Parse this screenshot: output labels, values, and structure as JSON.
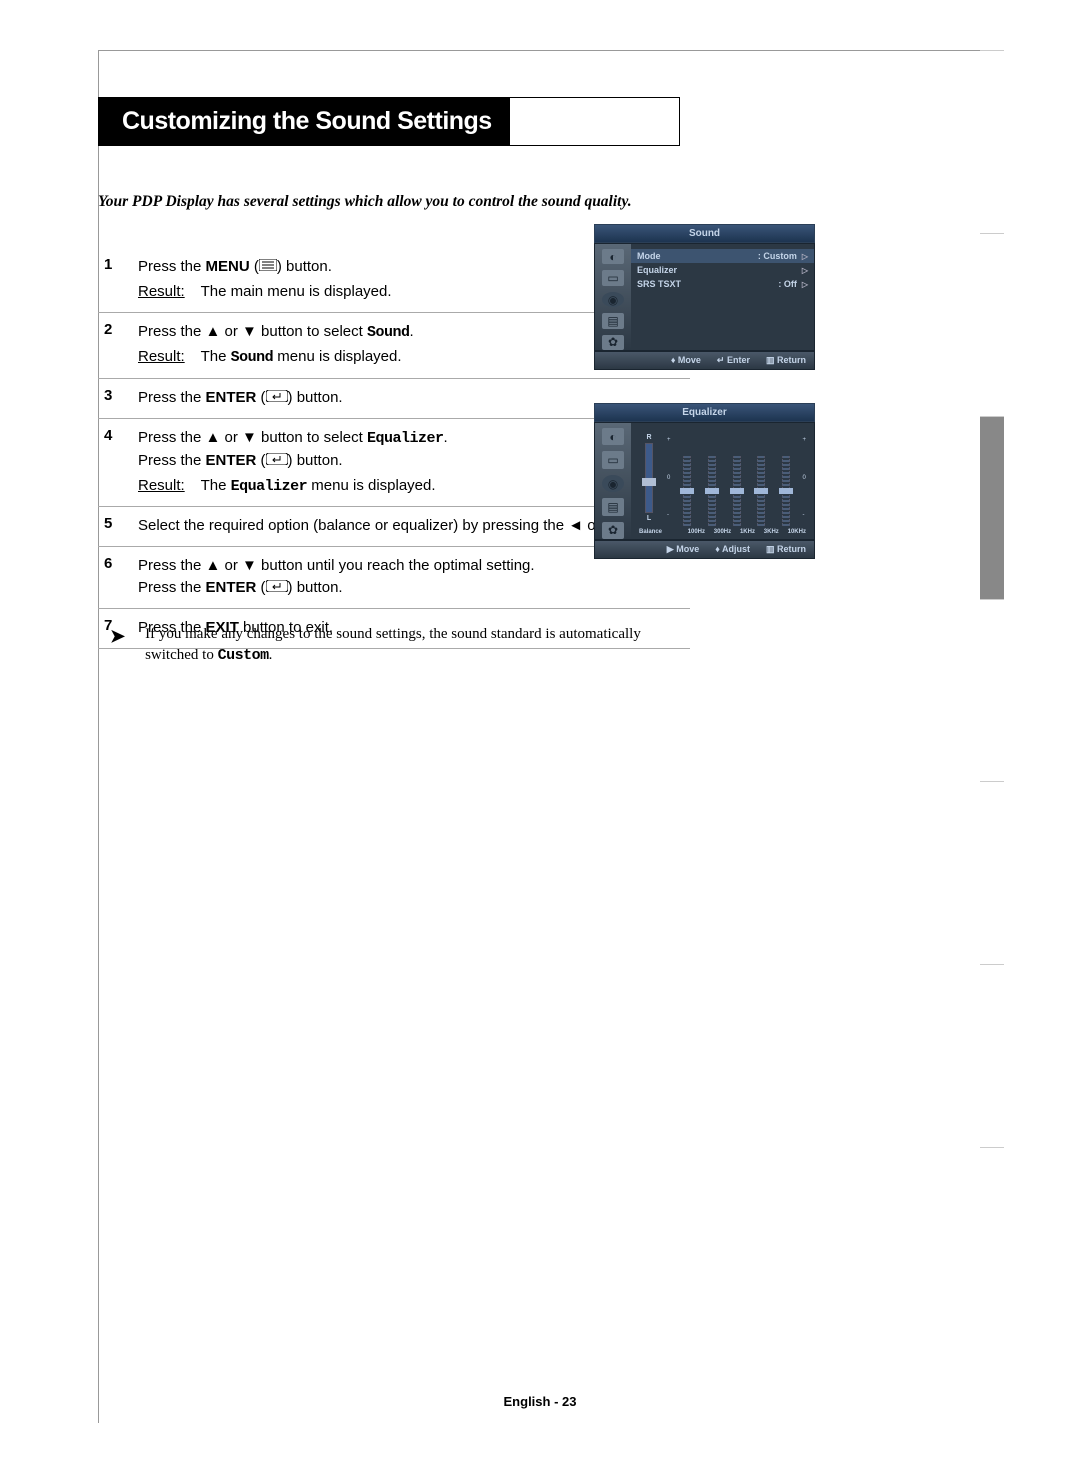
{
  "title": "Customizing the Sound Settings",
  "intro": "Your PDP Display has several settings which allow you to control the sound quality.",
  "steps": {
    "s1": {
      "num": "1",
      "a": "Press the ",
      "b": "MENU",
      "c": " (",
      "d": ") button.",
      "result_label": "Result:",
      "result": "The main menu is displayed."
    },
    "s2": {
      "num": "2",
      "a": "Press the ▲ or ▼ button to select ",
      "b": "Sound",
      "c": ".",
      "result_label": "Result:",
      "result_a": "The ",
      "result_b": "Sound",
      "result_c": " menu is displayed."
    },
    "s3": {
      "num": "3",
      "a": "Press the ",
      "b": "ENTER",
      "c": " (",
      "d": ") button."
    },
    "s4": {
      "num": "4",
      "a": "Press the ▲ or ▼ button to select ",
      "b": "Equalizer",
      "c": ".",
      "l2a": "Press the ",
      "l2b": "ENTER",
      "l2c": " (",
      "l2d": ") button.",
      "result_label": "Result:",
      "result_a": "The ",
      "result_b": "Equalizer",
      "result_c": " menu is displayed."
    },
    "s5": {
      "num": "5",
      "a": "Select the required option (balance or equalizer) by pressing the ◄ or ► button."
    },
    "s6": {
      "num": "6",
      "a": "Press the ▲ or ▼ button until you reach the optimal setting.",
      "l2a": "Press the ",
      "l2b": "ENTER",
      "l2c": " (",
      "l2d": ") button."
    },
    "s7": {
      "num": "7",
      "a": "Press the ",
      "b": "EXIT",
      "c": " button to exit."
    }
  },
  "note": {
    "a": "If you make any changes to the sound settings, the sound standard is automatically switched to ",
    "b": "Custom",
    "c": "."
  },
  "osd1": {
    "title": "Sound",
    "rows": {
      "r1": {
        "label": "Mode",
        "value": ":  Custom"
      },
      "r2": {
        "label": "Equalizer",
        "value": ""
      },
      "r3": {
        "label": "SRS TSXT",
        "value": ":  Off"
      }
    },
    "footer": {
      "move": "Move",
      "enter": "Enter",
      "return": "Return"
    }
  },
  "osd2": {
    "title": "Equalizer",
    "balance_label": "Balance",
    "lr": {
      "r": "R",
      "l": "L"
    },
    "scale": {
      "plus": "+",
      "zero": "0",
      "minus": "-"
    },
    "freqs": [
      "100Hz",
      "300Hz",
      "1KHz",
      "3KHz",
      "10KHz"
    ],
    "footer": {
      "move": "Move",
      "adjust": "Adjust",
      "return": "Return"
    }
  },
  "footer": "English - 23"
}
